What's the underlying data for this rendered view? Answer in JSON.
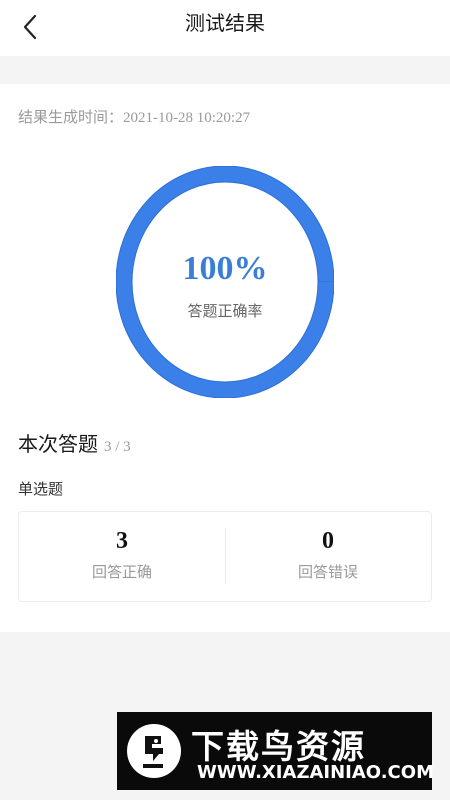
{
  "header": {
    "title": "测试结果",
    "back_icon": "chevron-left-icon"
  },
  "result": {
    "generated_label": "结果生成时间：",
    "generated_time": "2021-10-28 10:20:27",
    "accuracy_percent": "100%",
    "accuracy_value": 1.0,
    "accuracy_label": "答题正确率",
    "ring_color": "#3a80e8"
  },
  "summary": {
    "title": "本次答题",
    "count": "3 / 3",
    "question_type": "单选题",
    "correct_value": "3",
    "correct_label": "回答正确",
    "wrong_value": "0",
    "wrong_label": "回答错误"
  },
  "watermark": {
    "title": "下载鸟资源",
    "url": "WWW.XIAZAINIAO.COM"
  }
}
